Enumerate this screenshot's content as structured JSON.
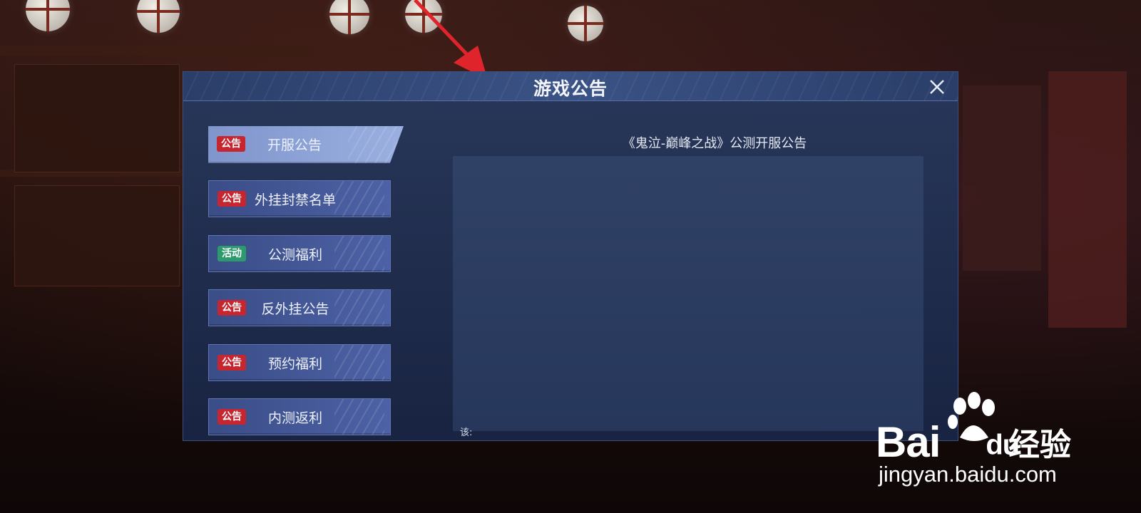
{
  "dialog": {
    "title": "游戏公告"
  },
  "tabs": [
    {
      "badge": "公告",
      "badge_color": "#c5262f",
      "label": "开服公告",
      "active": true
    },
    {
      "badge": "公告",
      "badge_color": "#c5262f",
      "label": "外挂封禁名单",
      "active": false
    },
    {
      "badge": "活动",
      "badge_color": "#2d9a6e",
      "label": "公测福利",
      "active": false
    },
    {
      "badge": "公告",
      "badge_color": "#c5262f",
      "label": "反外挂公告",
      "active": false
    },
    {
      "badge": "公告",
      "badge_color": "#c5262f",
      "label": "预约福利",
      "active": false
    },
    {
      "badge": "公告",
      "badge_color": "#c5262f",
      "label": "内测返利",
      "active": false
    }
  ],
  "content": {
    "title": "《鬼泣-巅峰之战》公测开服公告",
    "partial_text": "该:"
  },
  "watermark": {
    "brand": "Bai",
    "brand_suffix": "du",
    "cn": "经验",
    "url": "jingyan.baidu.com"
  },
  "colors": {
    "accent_red": "#e0242b",
    "panel": "#243660"
  }
}
